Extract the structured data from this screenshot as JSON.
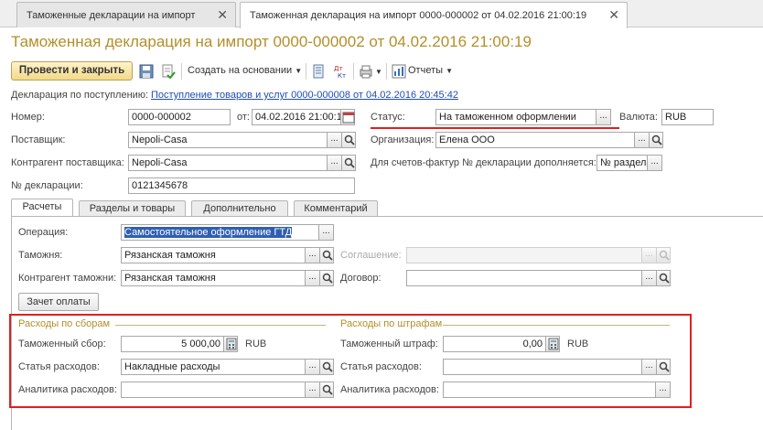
{
  "window_tabs": [
    {
      "label": "Таможенные декларации на импорт"
    },
    {
      "label": "Таможенная декларация на импорт 0000-000002 от 04.02.2016 21:00:19"
    }
  ],
  "page_title": "Таможенная декларация на импорт 0000-000002 от 04.02.2016 21:00:19",
  "toolbar": {
    "post_close_label": "Провести и закрыть",
    "create_based_label": "Создать на основании",
    "reports_label": "Отчеты"
  },
  "basis": {
    "label": "Декларация по поступлению:",
    "link": "Поступление товаров и услуг 0000-000008 от 04.02.2016 20:45:42"
  },
  "header": {
    "number_label": "Номер:",
    "number_value": "0000-000002",
    "date_label": "от:",
    "date_value": "04.02.2016 21:00:19",
    "status_label": "Статус:",
    "status_value": "На таможенном оформлении",
    "currency_label": "Валюта:",
    "currency_value": "RUB",
    "supplier_label": "Поставщик:",
    "supplier_value": "Nepoli-Casa",
    "org_label": "Организация:",
    "org_value": "Елена ООО",
    "contractor_label": "Контрагент поставщика:",
    "contractor_value": "Nepoli-Casa",
    "invoice_label": "Для счетов-фактур № декларации дополняется:",
    "invoice_value": "№ раздела",
    "decl_label": "№ декларации:",
    "decl_value": "0121345678"
  },
  "form_tabs": [
    {
      "label": "Расчеты"
    },
    {
      "label": "Разделы и товары"
    },
    {
      "label": "Дополнительно"
    },
    {
      "label": "Комментарий"
    }
  ],
  "calc": {
    "operation_label": "Операция:",
    "operation_value": "Самостоятельное оформление ГТД",
    "customs_label": "Таможня:",
    "customs_value": "Рязанская таможня",
    "agreement_label": "Соглашение:",
    "agreement_value": "",
    "customs_contractor_label": "Контрагент таможни:",
    "customs_contractor_value": "Рязанская таможня",
    "contract_label": "Договор:",
    "contract_value": "",
    "pay_button": "Зачет оплаты"
  },
  "fees": {
    "group_label": "Расходы по сборам",
    "fee_label": "Таможенный сбор:",
    "fee_value": "5 000,00",
    "fee_currency": "RUB",
    "item_label": "Статья расходов:",
    "item_value": "Накладные расходы",
    "analytics_label": "Аналитика расходов:",
    "analytics_value": ""
  },
  "fines": {
    "group_label": "Расходы по штрафам",
    "fine_label": "Таможенный штраф:",
    "fine_value": "0,00",
    "fine_currency": "RUB",
    "item_label": "Статья расходов:",
    "item_value": "",
    "analytics_label": "Аналитика расходов:",
    "analytics_value": ""
  },
  "colors": {
    "accent": "#b38f2a",
    "link": "#1f4db3",
    "highlight": "#e02020"
  }
}
